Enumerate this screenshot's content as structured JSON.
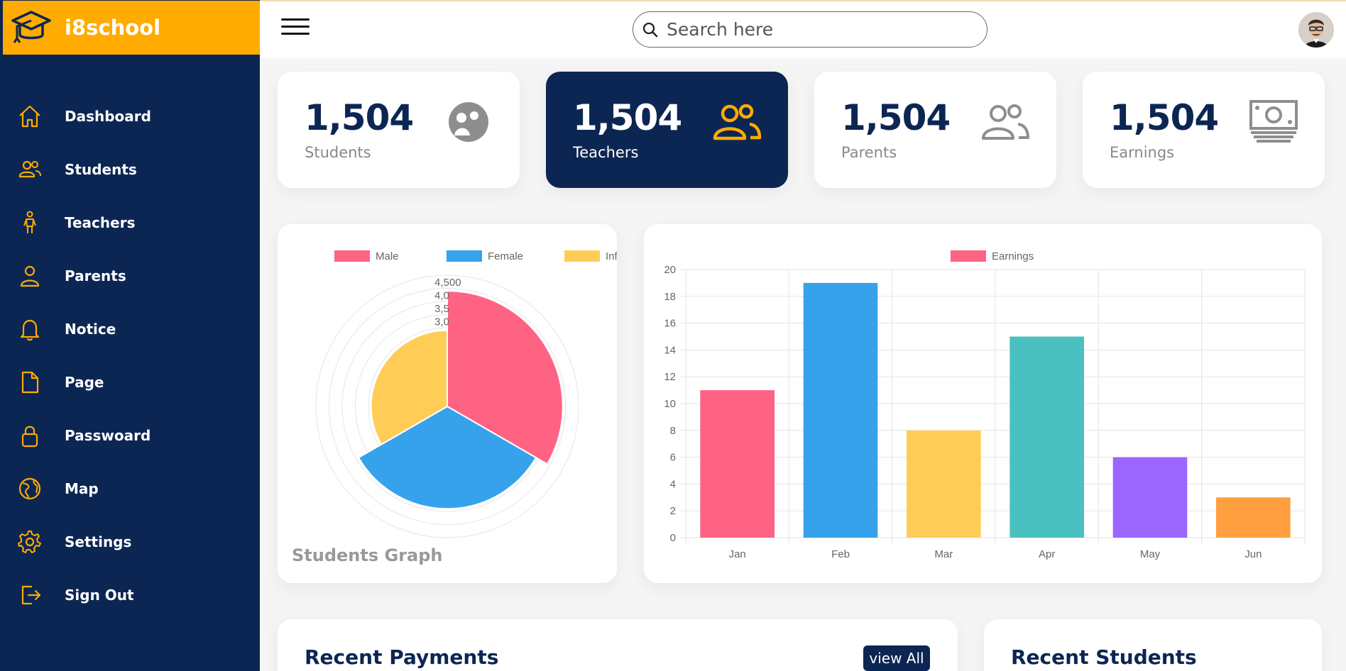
{
  "app": {
    "name": "i8school"
  },
  "sidebar": {
    "items": [
      {
        "label": "Dashboard",
        "icon": "home-icon"
      },
      {
        "label": "Students",
        "icon": "users-icon"
      },
      {
        "label": "Teachers",
        "icon": "person-standing-icon"
      },
      {
        "label": "Parents",
        "icon": "person-icon"
      },
      {
        "label": "Notice",
        "icon": "bell-icon"
      },
      {
        "label": "Page",
        "icon": "document-icon"
      },
      {
        "label": "Passwoard",
        "icon": "lock-icon"
      },
      {
        "label": "Map",
        "icon": "globe-icon"
      },
      {
        "label": "Settings",
        "icon": "gear-icon"
      },
      {
        "label": "Sign Out",
        "icon": "sign-out-icon"
      }
    ]
  },
  "topbar": {
    "search_placeholder": "Search here"
  },
  "stats": [
    {
      "value": "1,504",
      "label": "Students",
      "icon": "student-face-icon",
      "active": false
    },
    {
      "value": "1,504",
      "label": "Teachers",
      "icon": "teachers-group-icon",
      "active": true
    },
    {
      "value": "1,504",
      "label": "Parents",
      "icon": "parents-group-icon",
      "active": false
    },
    {
      "value": "1,504",
      "label": "Earnings",
      "icon": "cash-icon",
      "active": false
    }
  ],
  "colors": {
    "navy": "#0c2653",
    "accent": "#ffab00"
  },
  "chart_data": [
    {
      "type": "polarArea",
      "title": "Students Graph",
      "categories": [
        "Male",
        "Female",
        "Infant"
      ],
      "values": [
        4400,
        3900,
        2900
      ],
      "colors": [
        "#ff6384",
        "#36a2eb",
        "#ffcd56"
      ],
      "radial_ticks": [
        "4,500",
        "4,0",
        "3,5",
        "3,0"
      ],
      "legend": "top"
    },
    {
      "type": "bar",
      "categories": [
        "Jan",
        "Feb",
        "Mar",
        "Apr",
        "May",
        "Jun"
      ],
      "series": [
        {
          "name": "Earnings",
          "values": [
            11,
            19,
            8,
            15,
            6,
            3
          ]
        }
      ],
      "colors": [
        "#ff6384",
        "#36a2eb",
        "#ffcd56",
        "#4bc0c0",
        "#9966ff",
        "#ff9f40"
      ],
      "ylim": [
        0,
        20
      ],
      "yticks": [
        "0",
        "2",
        "4",
        "6",
        "8",
        "10",
        "12",
        "14",
        "16",
        "18",
        "20"
      ],
      "grid": true,
      "legend": "top"
    }
  ],
  "bottom": {
    "payments_title": "Recent Payments",
    "view_all": "view All",
    "students_title": "Recent Students"
  }
}
